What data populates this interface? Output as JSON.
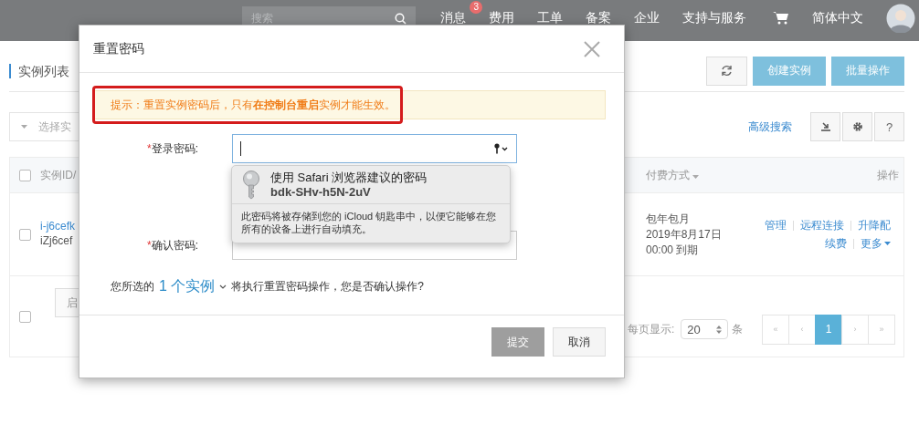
{
  "topbar": {
    "search_placeholder": "搜索",
    "nav": [
      {
        "label": "消息",
        "badge": "3"
      },
      {
        "label": "费用"
      },
      {
        "label": "工单"
      },
      {
        "label": "备案"
      },
      {
        "label": "企业"
      },
      {
        "label": "支持与服务"
      }
    ],
    "language": "简体中文"
  },
  "page": {
    "title": "实例列表",
    "buttons": [
      "创建实例",
      "批量操作"
    ],
    "filter": {
      "placeholder": "选择实"
    },
    "advanced_search": "高级搜索",
    "help": "?",
    "table": {
      "header": {
        "checked": false,
        "column_1": "实例ID/",
        "billing": "付费方式",
        "actions": "操作"
      },
      "rows": [
        {
          "checked": false,
          "id": "i-j6cefk",
          "name": "iZj6cef",
          "billing": [
            "包年包月",
            "2019年8月17日",
            "00:00 到期"
          ],
          "actions": [
            [
              "管理",
              "远程连接",
              "升降配"
            ],
            [
              "续费",
              "更多"
            ]
          ]
        }
      ],
      "footer": {
        "checked": false,
        "button": "启",
        "page_size_label": "每页显示:",
        "page_size": "20",
        "unit": "条",
        "pages": [
          {
            "label": "«",
            "selected": false
          },
          {
            "label": "‹",
            "selected": false
          },
          {
            "label": "1",
            "selected": true
          },
          {
            "label": "›",
            "selected": false
          },
          {
            "label": "»",
            "selected": false
          }
        ]
      }
    }
  },
  "modal": {
    "title": "重置密码",
    "notice": "提示：重置实例密码后，只有**在控制台重启**实例才能生效。",
    "fields": [
      {
        "required_mark": "*",
        "label": "登录密码:",
        "focused": true
      },
      {
        "required_mark": "*",
        "label": "确认密码:",
        "focused": false
      }
    ],
    "summary": {
      "before": "您所选的",
      "link": "1 个实例",
      "after": "将执行重置密码操作，您是否确认操作?"
    },
    "buttons": [
      {
        "label": "提交",
        "disabled": true
      },
      {
        "label": "取消",
        "disabled": false
      }
    ],
    "suggestion": {
      "title": "使用 Safari 浏览器建议的密码",
      "password": "bdk-SHv-h5N-2uV",
      "note": "此密码将被存储到您的 iCloud 钥匙串中，以便它能够在您所有的设备上进行自动填充。"
    }
  }
}
